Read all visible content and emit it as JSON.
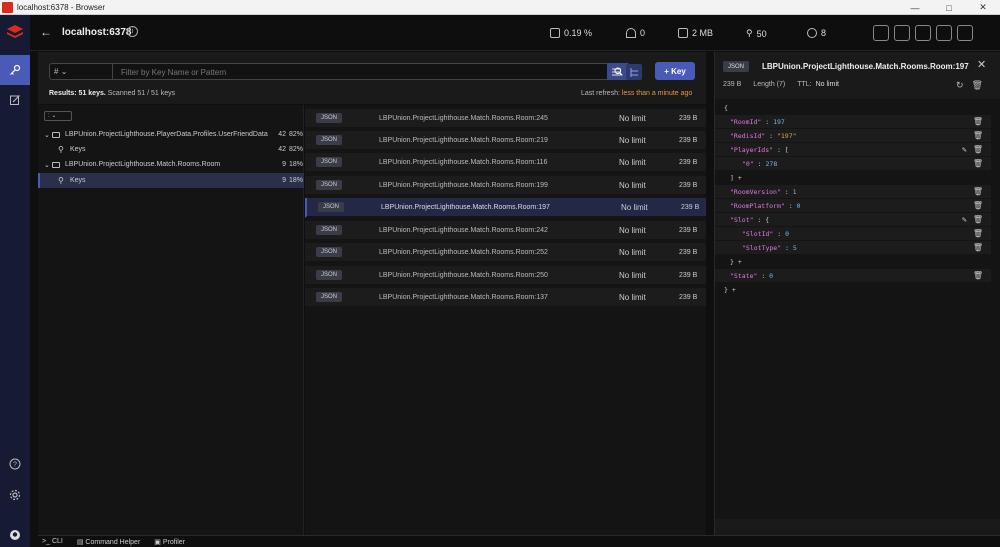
{
  "window": {
    "title": "localhost:6378 - Browser"
  },
  "header": {
    "host": "localhost:6378",
    "stats": {
      "cpu": "0.19 %",
      "ops": "0",
      "memory": "2 MB",
      "keys": "50",
      "clients": "8"
    }
  },
  "filter": {
    "type_label": "#",
    "search_placeholder": "Filter by Key Name or Pattern",
    "add_key_label": "+ Key",
    "results_label": "Results: 51 keys.",
    "scanned_label": "Scanned 51 / 51 keys",
    "refresh_label": "Last refresh:",
    "refresh_value": "less than a minute ago"
  },
  "tree": {
    "delimiter": ":",
    "nodes": [
      {
        "label": "LBPUnion.ProjectLighthouse.PlayerData.Profiles.UserFriendData",
        "count": "42",
        "pct": "82%"
      },
      {
        "label": "Keys",
        "count": "42",
        "pct": "82%"
      },
      {
        "label": "LBPUnion.ProjectLighthouse.Match.Rooms.Room",
        "count": "9",
        "pct": "18%"
      },
      {
        "label": "Keys",
        "count": "9",
        "pct": "18%"
      }
    ]
  },
  "keys": [
    {
      "type": "JSON",
      "name": "LBPUnion.ProjectLighthouse.Match.Rooms.Room:245",
      "ttl": "No limit",
      "size": "239 B"
    },
    {
      "type": "JSON",
      "name": "LBPUnion.ProjectLighthouse.Match.Rooms.Room:219",
      "ttl": "No limit",
      "size": "239 B"
    },
    {
      "type": "JSON",
      "name": "LBPUnion.ProjectLighthouse.Match.Rooms.Room:116",
      "ttl": "No limit",
      "size": "239 B"
    },
    {
      "type": "JSON",
      "name": "LBPUnion.ProjectLighthouse.Match.Rooms.Room:199",
      "ttl": "No limit",
      "size": "239 B"
    },
    {
      "type": "JSON",
      "name": "LBPUnion.ProjectLighthouse.Match.Rooms.Room:197",
      "ttl": "No limit",
      "size": "239 B"
    },
    {
      "type": "JSON",
      "name": "LBPUnion.ProjectLighthouse.Match.Rooms.Room:242",
      "ttl": "No limit",
      "size": "239 B"
    },
    {
      "type": "JSON",
      "name": "LBPUnion.ProjectLighthouse.Match.Rooms.Room:252",
      "ttl": "No limit",
      "size": "239 B"
    },
    {
      "type": "JSON",
      "name": "LBPUnion.ProjectLighthouse.Match.Rooms.Room:250",
      "ttl": "No limit",
      "size": "239 B"
    },
    {
      "type": "JSON",
      "name": "LBPUnion.ProjectLighthouse.Match.Rooms.Room:137",
      "ttl": "No limit",
      "size": "239 B"
    }
  ],
  "detail": {
    "type": "JSON",
    "name": "LBPUnion.ProjectLighthouse.Match.Rooms.Room:197",
    "size": "239 B",
    "length_label": "Length (7)",
    "ttl_label": "TTL:",
    "ttl_value": "No limit",
    "json": {
      "open": "{",
      "roomid_key": "\"RoomId\"",
      "roomid_val": "197",
      "redisid_key": "\"RedisId\"",
      "redisid_val": "\"197\"",
      "playerids_key": "\"PlayerIds\"",
      "arr_open": "[",
      "p0_key": "\"0\"",
      "p0_val": "278",
      "arr_close": "]",
      "roomversion_key": "\"RoomVersion\"",
      "roomversion_val": "1",
      "roomplatform_key": "\"RoomPlatform\"",
      "roomplatform_val": "0",
      "slot_key": "\"Slot\"",
      "obj_open": "{",
      "slotid_key": "\"SlotId\"",
      "slotid_val": "0",
      "slottype_key": "\"SlotType\"",
      "slottype_val": "5",
      "obj_close": "}",
      "state_key": "\"State\"",
      "state_val": "0",
      "close": "}"
    }
  },
  "bottom": {
    "cli": "CLI",
    "command_helper": "Command Helper",
    "profiler": "Profiler"
  }
}
